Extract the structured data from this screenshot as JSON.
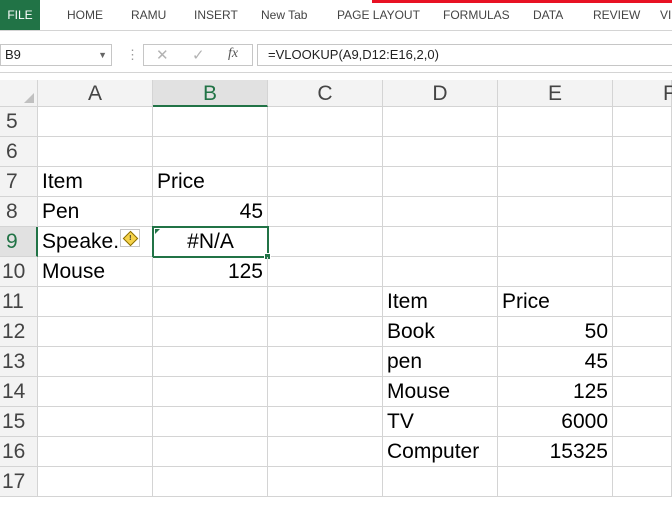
{
  "ribbon": {
    "tabs": [
      "FILE",
      "HOME",
      "RAMU",
      "INSERT",
      "New Tab",
      "PAGE LAYOUT",
      "FORMULAS",
      "DATA",
      "REVIEW",
      "VI"
    ]
  },
  "formula_bar": {
    "name_box": "B9",
    "cancel_glyph": "✕",
    "enter_glyph": "✓",
    "fx_glyph": "fx",
    "formula": "=VLOOKUP(A9,D12:E16,2,0)"
  },
  "columns": [
    "A",
    "B",
    "C",
    "D",
    "E",
    "F"
  ],
  "rows": [
    "5",
    "6",
    "7",
    "8",
    "9",
    "10",
    "11",
    "12",
    "13",
    "14",
    "15",
    "16",
    "17"
  ],
  "cells": {
    "A7": "Item",
    "B7": "Price",
    "A8": "Pen",
    "B8": "45",
    "A9": "Speake.",
    "B9": "#N/A",
    "A10": "Mouse",
    "B10": "125",
    "D11": "Item",
    "E11": "Price",
    "D12": "Book",
    "E12": "50",
    "D13": "pen",
    "E13": "45",
    "D14": "Mouse",
    "E14": "125",
    "D15": "TV",
    "E15": "6000",
    "D16": "Computer",
    "E16": "15325"
  },
  "selection": {
    "active_cell": "B9",
    "column": "B",
    "row": "9"
  },
  "icons": {
    "error_indicator": "warning-diamond-icon"
  },
  "colors": {
    "excel_green": "#217346",
    "title_red": "#e81123",
    "warning_yellow": "#f6d34a"
  }
}
